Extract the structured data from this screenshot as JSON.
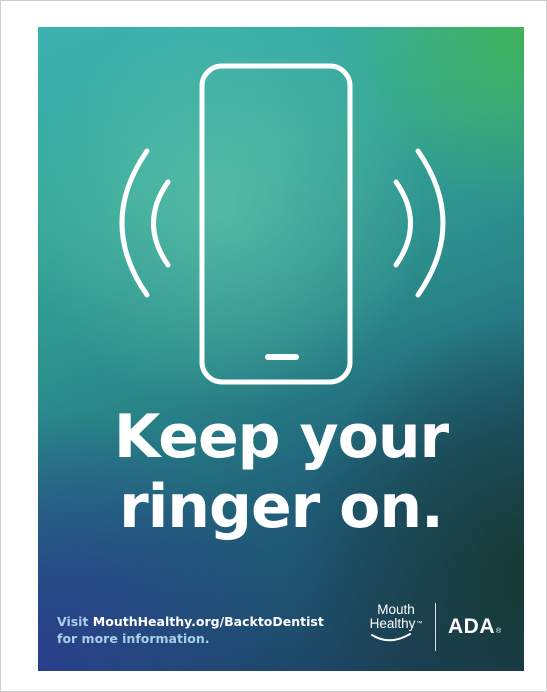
{
  "poster": {
    "headline_line1": "Keep your",
    "headline_line2": "ringer on.",
    "footer_prefix": "Visit ",
    "footer_url": "MouthHealthy.org/BacktoDentist",
    "footer_line2": "for more information.",
    "logos": {
      "mouth_healthy_line1": "Mouth",
      "mouth_healthy_line2": "Healthy",
      "mouth_healthy_tm": "™",
      "ada": "ADA",
      "ada_reg": "®"
    },
    "icons": [
      "ringing-phone-icon",
      "sound-waves-left-icon",
      "sound-waves-right-icon",
      "smile-swoosh-icon"
    ],
    "colors": {
      "text": "#ffffff",
      "footer_text": "#a7d1e8",
      "gradient_top_right": "#3fb35a",
      "gradient_bottom_left": "#2a3f8c",
      "gradient_teal": "#3cb3b0"
    }
  }
}
